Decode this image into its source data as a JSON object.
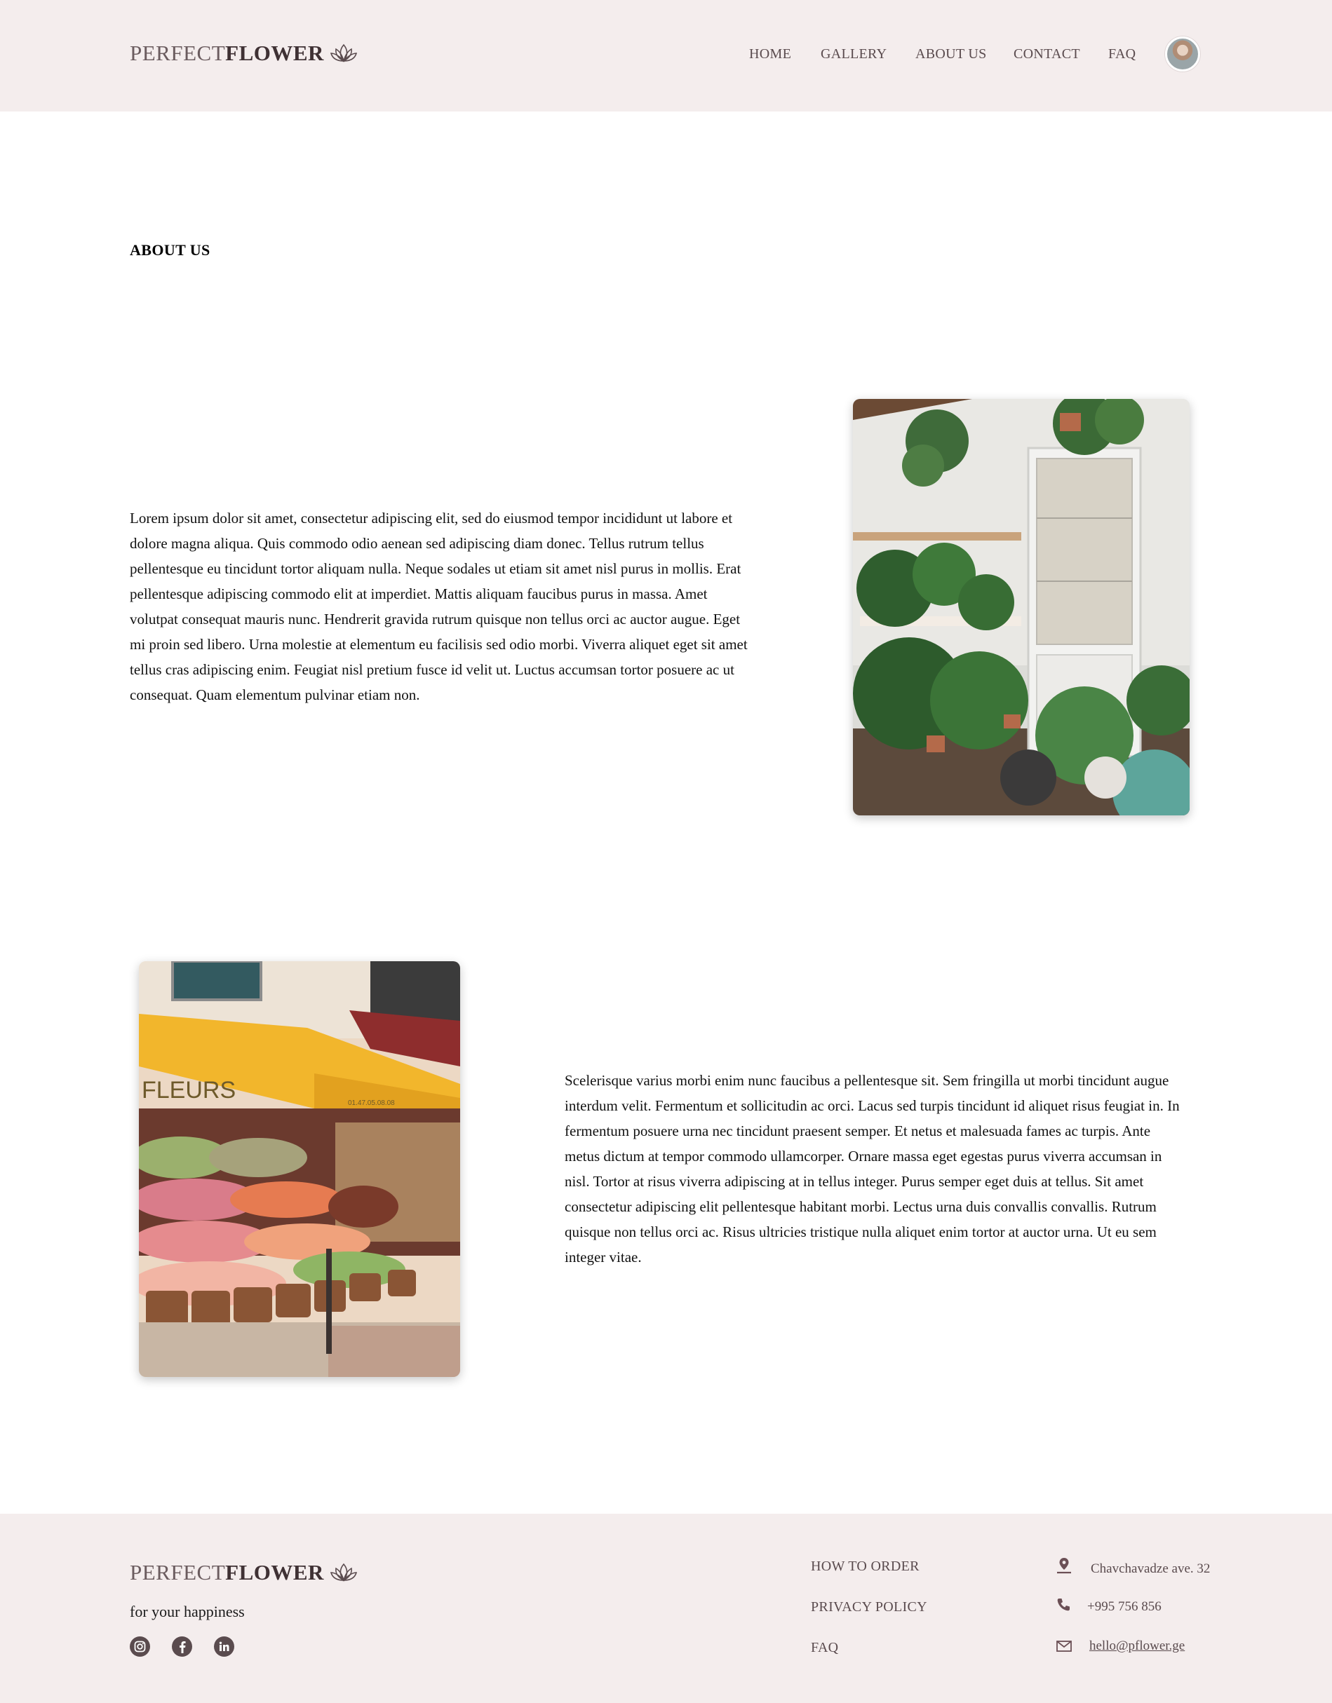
{
  "header": {
    "logo": {
      "light": "PERFECT",
      "bold": "FLOWER",
      "icon": "lotus-icon"
    },
    "nav": [
      "HOME",
      "GALLERY",
      "ABOUT US",
      "CONTACT",
      "FAQ"
    ],
    "avatar": "user-avatar"
  },
  "main": {
    "title": "ABOUT US",
    "section1": {
      "text": "Lorem ipsum dolor sit amet, consectetur adipiscing elit, sed do eiusmod tempor incididunt ut labore et dolore magna aliqua. Quis commodo odio aenean sed adipiscing diam donec. Tellus rutrum tellus pellentesque eu tincidunt tortor aliquam nulla. Neque sodales ut etiam sit amet nisl purus in mollis. Erat pellentesque adipiscing commodo elit at imperdiet. Mattis aliquam faucibus purus in massa. Amet volutpat consequat mauris nunc. Hendrerit gravida rutrum quisque non tellus orci ac auctor augue. Eget mi proin sed libero. Urna molestie at elementum eu facilisis sed odio morbi. Viverra aliquet eget sit amet tellus cras adipiscing enim. Feugiat nisl pretium fusce id velit ut. Luctus accumsan tortor posuere ac ut consequat. Quam elementum pulvinar etiam non.",
      "image": "plant-shop-interior-photo"
    },
    "section2": {
      "text": "Scelerisque varius morbi enim nunc faucibus a pellentesque sit. Sem fringilla ut morbi tincidunt augue interdum velit. Fermentum et sollicitudin ac orci. Lacus sed turpis tincidunt id aliquet risus feugiat in. In fermentum posuere urna nec tincidunt praesent semper. Et netus et malesuada fames ac turpis. Ante metus dictum at tempor commodo ullamcorper. Ornare massa eget egestas purus viverra accumsan in nisl. Tortor at risus viverra adipiscing at in tellus integer. Purus semper eget duis at tellus. Sit amet consectetur adipiscing elit pellentesque habitant morbi. Lectus urna duis convallis convallis. Rutrum quisque non tellus orci ac. Risus ultricies tristique nulla aliquet enim tortor at auctor urna. Ut eu sem integer vitae.",
      "image": "flower-shop-storefront-photo",
      "sign_text": "FLEURS",
      "sign_phone": "01.47.05.08.08"
    }
  },
  "footer": {
    "logo": {
      "light": "PERFECT",
      "bold": "FLOWER"
    },
    "tagline": "for your happiness",
    "social": [
      "instagram-icon",
      "facebook-icon",
      "linkedin-icon"
    ],
    "links": [
      "HOW TO ORDER",
      "PRIVACY POLICY",
      "FAQ"
    ],
    "contact": {
      "address": "Chavchavadze ave. 32",
      "phone": "+995 756 856",
      "email": "hello@pflower.ge"
    }
  },
  "colors": {
    "header_bg": "#f4eded",
    "footer_bg": "#f4eded",
    "nav_text": "#5a4b4e",
    "accent": "#3f3134"
  }
}
